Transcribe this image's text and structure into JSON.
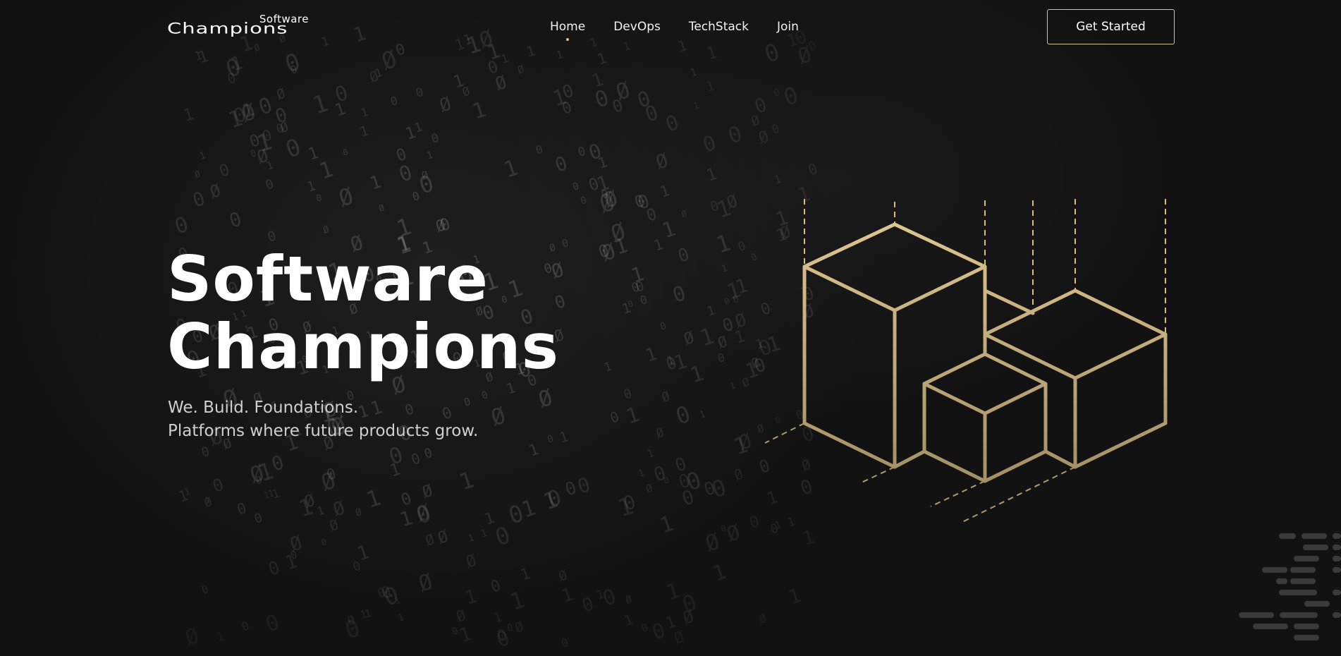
{
  "header": {
    "logo": {
      "top_word": "Software",
      "main_word": "Champions"
    },
    "nav": [
      {
        "label": "Home",
        "active": true
      },
      {
        "label": "DevOps",
        "active": false
      },
      {
        "label": "TechStack",
        "active": false
      },
      {
        "label": "Join",
        "active": false
      }
    ],
    "cta_label": "Get Started"
  },
  "hero": {
    "title_line1": "Software",
    "title_line2": "Champions",
    "subtitle_line1": "We. Build. Foundations.",
    "subtitle_line2": "Platforms where future products grow."
  },
  "colors": {
    "background": "#121212",
    "accent_gold": "#d9c28d",
    "text_primary": "#ffffff",
    "text_secondary": "#cfcfcf"
  },
  "icons": {
    "illustration": "isometric-cubes-illustration"
  }
}
